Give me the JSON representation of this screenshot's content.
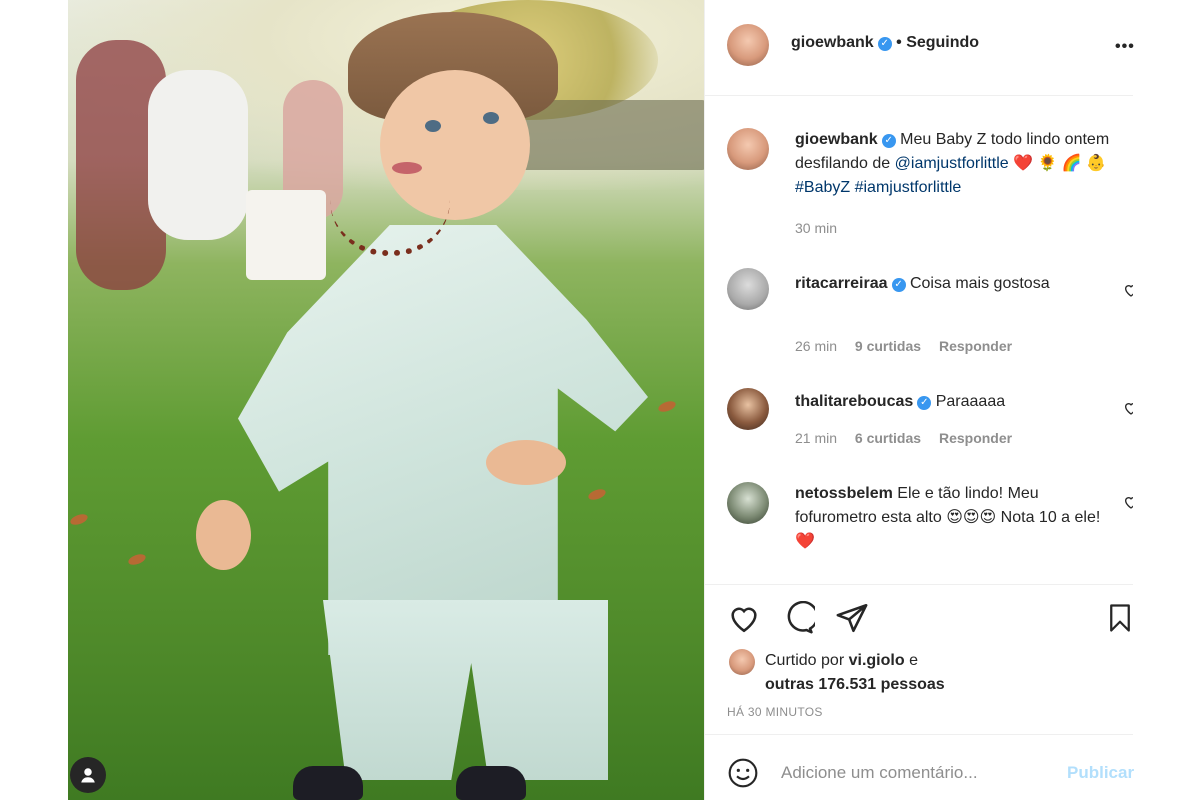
{
  "post": {
    "author": "gioewbank",
    "follow_status": "• Seguindo",
    "more_label": "•••",
    "caption": {
      "username": "gioewbank",
      "text_before": "Meu Baby Z todo lindo ontem desfilando de ",
      "mention": "@iamjustforlittle",
      "emojis": "❤️ 🌻 🌈 👶",
      "hashtags": "#BabyZ #iamjustforlittle",
      "time": "30 min"
    },
    "comments": [
      {
        "username": "ritacarreiraa",
        "verified": true,
        "text": "Coisa mais gostosa",
        "time": "26 min",
        "likes": "9 curtidas",
        "reply": "Responder"
      },
      {
        "username": "thalitareboucas",
        "verified": true,
        "text": "Paraaaaa",
        "time": "21 min",
        "likes": "6 curtidas",
        "reply": "Responder"
      },
      {
        "username": "netossbelem",
        "verified": false,
        "text": "Ele e tão lindo! Meu fofurometro esta alto 😍😍😍 Nota 10 a ele! ❤️",
        "time": "",
        "likes": "",
        "reply": ""
      }
    ],
    "likes": {
      "prefix": "Curtido por",
      "user": "vi.giolo",
      "connector": "e",
      "others": "outras 176.531 pessoas"
    },
    "timestamp": "HÁ 30 MINUTOS",
    "add_comment": {
      "placeholder": "Adicione um comentário...",
      "post_label": "Publicar"
    }
  },
  "colors": {
    "verified": "#3897f0",
    "link": "#00376b",
    "muted": "#8e8e8e",
    "post_button": "#b2dffc"
  }
}
